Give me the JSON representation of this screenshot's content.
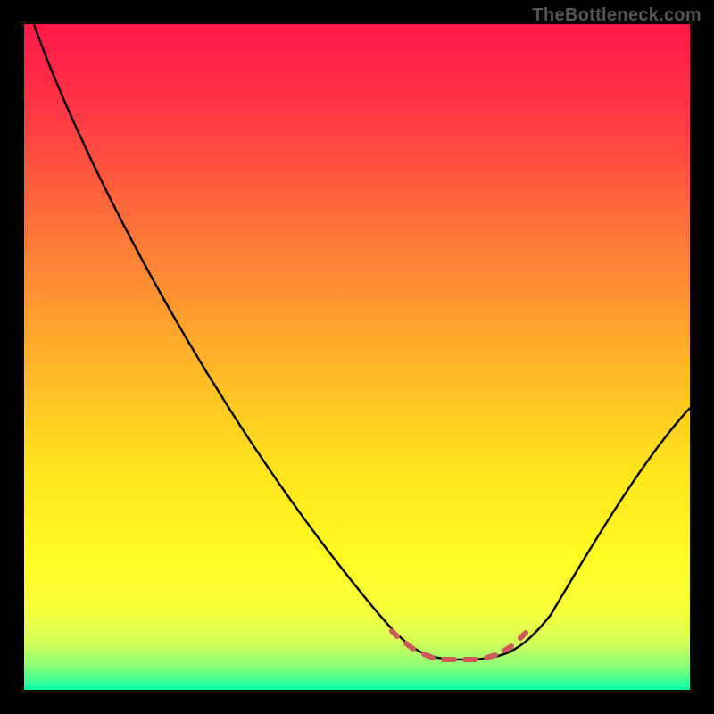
{
  "watermark": "TheBottleneck.com",
  "chart_data": {
    "type": "line",
    "title": "",
    "xlabel": "",
    "ylabel": "",
    "xlim": [
      0,
      100
    ],
    "ylim": [
      0,
      100
    ],
    "legend": false,
    "grid": false,
    "background": {
      "type": "vertical_gradient",
      "stops": [
        {
          "offset": 0.0,
          "color": "#ff1848"
        },
        {
          "offset": 0.14,
          "color": "#ff3a44"
        },
        {
          "offset": 0.32,
          "color": "#ff7838"
        },
        {
          "offset": 0.5,
          "color": "#ffb228"
        },
        {
          "offset": 0.66,
          "color": "#ffe21c"
        },
        {
          "offset": 0.8,
          "color": "#fffb22"
        },
        {
          "offset": 0.88,
          "color": "#f9ff3c"
        },
        {
          "offset": 0.93,
          "color": "#d2ff58"
        },
        {
          "offset": 0.965,
          "color": "#88ff78"
        },
        {
          "offset": 0.99,
          "color": "#30ff9a"
        },
        {
          "offset": 1.0,
          "color": "#00ffa8"
        }
      ]
    },
    "series": [
      {
        "name": "bottleneck-curve",
        "color": "#000000",
        "x": [
          1.5,
          10,
          20,
          30,
          40,
          50,
          55,
          60,
          63,
          66,
          70,
          74,
          78,
          82,
          88,
          94,
          100
        ],
        "values": [
          100,
          83,
          65,
          48,
          32,
          15,
          10,
          6,
          4,
          3,
          3.5,
          5,
          9,
          17,
          28,
          37,
          42
        ]
      }
    ],
    "annotations": [
      {
        "type": "marker_range",
        "name": "optimal-zone",
        "color": "#cc5a5a",
        "x_start": 55,
        "x_end": 76,
        "y": 4
      }
    ]
  }
}
